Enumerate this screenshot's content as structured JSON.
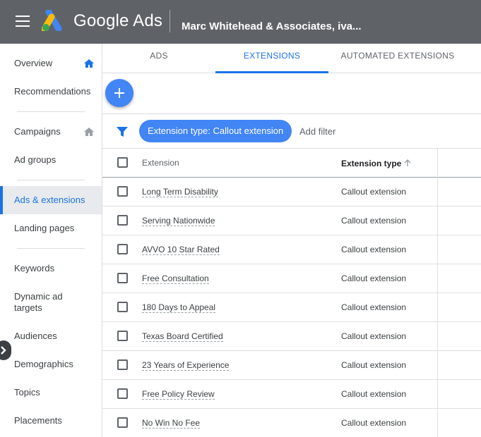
{
  "header": {
    "brand": "Google Ads",
    "account": "Marc Whitehead & Associates, iva..."
  },
  "sidebar": {
    "items": [
      {
        "label": "Overview"
      },
      {
        "label": "Recommendations"
      },
      {
        "label": "Campaigns"
      },
      {
        "label": "Ad groups"
      },
      {
        "label": "Ads & extensions"
      },
      {
        "label": "Landing pages"
      },
      {
        "label": "Keywords"
      },
      {
        "label": "Dynamic ad targets"
      },
      {
        "label": "Audiences"
      },
      {
        "label": "Demographics"
      },
      {
        "label": "Topics"
      },
      {
        "label": "Placements"
      }
    ],
    "active": "Ads & extensions"
  },
  "tabs": [
    {
      "label": "ADS"
    },
    {
      "label": "EXTENSIONS"
    },
    {
      "label": "AUTOMATED EXTENSIONS"
    }
  ],
  "active_tab": "EXTENSIONS",
  "filter": {
    "chip": "Extension type: Callout extension",
    "add_label": "Add filter"
  },
  "table": {
    "headers": {
      "extension": "Extension",
      "type": "Extension type"
    },
    "rows": [
      {
        "extension": "Long Term Disability",
        "type": "Callout extension"
      },
      {
        "extension": "Serving Nationwide",
        "type": "Callout extension"
      },
      {
        "extension": "AVVO 10 Star Rated",
        "type": "Callout extension"
      },
      {
        "extension": "Free Consultation",
        "type": "Callout extension"
      },
      {
        "extension": "180 Days to Appeal",
        "type": "Callout extension"
      },
      {
        "extension": "Texas Board Certified",
        "type": "Callout extension"
      },
      {
        "extension": "23 Years of Experience",
        "type": "Callout extension"
      },
      {
        "extension": "Free Policy Review",
        "type": "Callout extension"
      },
      {
        "extension": "No Win No Fee",
        "type": "Callout extension"
      }
    ]
  },
  "colors": {
    "topbar": "#5f6368",
    "accent": "#1a73e8",
    "fab": "#4285f4"
  }
}
